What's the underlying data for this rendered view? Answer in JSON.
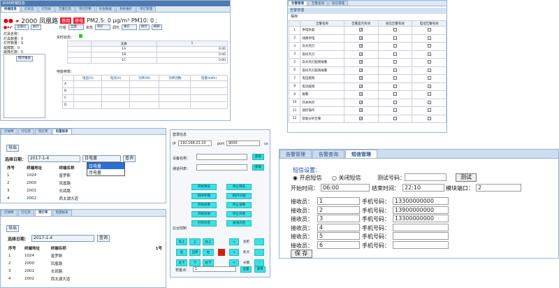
{
  "main": {
    "title": "2000终端信息",
    "tabs": [
      "终端信息",
      "灯状态",
      "灯列表",
      "告警信息",
      "单灯控制",
      "抄表数据",
      "系统维护",
      "单灯管理"
    ],
    "station": "2000 凤凰路",
    "badge1": "停用",
    "badge2": "停电",
    "pm": "PM2.5: 0 μg/m³ PM10: 0 ;",
    "sel1": "全部灯",
    "btn1": "执行",
    "lbl2": "灯组",
    "sel2": "全部",
    "lbl3": "状态",
    "sel3": "开灯",
    "lbl4": "调光",
    "sel4": "关灯",
    "btn2": "执行",
    "btn3": "刷新",
    "left": [
      "灯具名称：",
      "灯具数量：0",
      "灯杆数量：0",
      "故障数：0",
      "故障灯数：0"
    ],
    "stat_btn": "统计报表",
    "status_label": "实时状态：",
    "phase_head": [
      "",
      "支路",
      "1"
    ],
    "phase_rows": [
      [
        "1A",
        "0.00"
      ],
      [
        "1B",
        "0.00"
      ],
      [
        "1C",
        "0.00"
      ]
    ],
    "energy_label": "电能参数：",
    "energy_head": [
      "",
      "电压(V)",
      "电流(A)",
      "功率(W)",
      "功率因数",
      "电量(kWh)"
    ],
    "energy_rows": [
      "A",
      "B",
      "C",
      "D"
    ]
  },
  "alarm": {
    "tabs": [
      "告警管理",
      "告警查询",
      "短信管理"
    ],
    "title": "告警管理",
    "save": "保存",
    "head": [
      "",
      "告警名称",
      "告警是否有效",
      "短信告警有效",
      "电话告警有效"
    ],
    "rows": [
      [
        "1",
        "供电恢复"
      ],
      [
        "2",
        "线路停电"
      ],
      [
        "3",
        "白天亮灯"
      ],
      [
        "4",
        "夜间灭灯"
      ],
      [
        "5",
        "白天亮灯超限报警"
      ],
      [
        "6",
        "夜间灭灯超限报警"
      ],
      [
        "7",
        "电压越限"
      ],
      [
        "8",
        "电流越限"
      ],
      [
        "9",
        "报警"
      ],
      [
        "10",
        "开关失控"
      ],
      [
        "11",
        "遥控操作"
      ],
      [
        "12",
        "智能分析告警"
      ]
    ]
  },
  "report1": {
    "tabs": [
      "灯故障",
      "灯信息",
      "亮灯率",
      "电量报表"
    ],
    "export": "导出",
    "date_label": "选择日期：",
    "date": "2017-1-4",
    "sel": "日电量",
    "btn": "查询",
    "options": [
      "日电量",
      "月电量"
    ],
    "head": [
      "序号",
      "终端地址",
      "终端名称"
    ],
    "rows": [
      [
        "1",
        "1024",
        "普罗斯"
      ],
      [
        "2",
        "2000",
        "凤凰路"
      ],
      [
        "3",
        "2001",
        "长鸽路"
      ],
      [
        "4",
        "2002",
        "西太湖大道"
      ]
    ]
  },
  "report2": {
    "tabs": [
      "灯故障",
      "灯信息",
      "亮灯率",
      "电量报表"
    ],
    "export": "导出",
    "date_label": "选择日期：",
    "date": "2017-1-4",
    "btn": "查询",
    "head": [
      "序号",
      "终端地址",
      "终端名称",
      "1号"
    ],
    "rows": [
      [
        "1",
        "1024",
        "普罗斯"
      ],
      [
        "2",
        "2000",
        "凤凰路"
      ],
      [
        "3",
        "2001",
        "长鸽路"
      ],
      [
        "4",
        "2002",
        "西太湖大道"
      ]
    ]
  },
  "video": {
    "title": "登录信息",
    "ip_label": "IP",
    "ip": "192.168.22.10",
    "port_label": "port",
    "port": "9000",
    "us": "us",
    "dev_label": "设备名称：",
    "get1": "获取",
    "ch_label": "通道列表：",
    "get2": "获取",
    "btns": [
      "开始预览",
      "停止预览",
      "抓BMP图",
      "抓JPEG图",
      "开始录像",
      "停止录像",
      "开始对讲",
      "停止对讲",
      "打开声音",
      "关闭声音"
    ],
    "ptz_label": "云台控制",
    "dirs": [
      "左上",
      "上",
      "右上",
      "左",
      "自转",
      "右",
      "左下",
      "下",
      "右下"
    ],
    "side": [
      "+",
      "变距",
      "-",
      "+",
      "焦点",
      "-",
      "+",
      "光圈",
      "-"
    ],
    "preset_label": "预置点：",
    "preset": "1",
    "set": "设置",
    "call": "调用"
  },
  "sms": {
    "tabs": [
      "告警管理",
      "告警查询",
      "短信管理"
    ],
    "title": "短信设置：",
    "on": "开启短信",
    "off": "关闭短信",
    "test_label": "测试号码：",
    "test_btn": "测试",
    "start_label": "开始时间：",
    "start": "06:00",
    "end_label": "结束时间：",
    "end": "22:10",
    "port_label": "模块端口：",
    "port": "2",
    "rows": [
      [
        "接收员：",
        "1",
        "手机号码：",
        "13300000000"
      ],
      [
        "接收员：",
        "2",
        "手机号码：",
        "13900000000"
      ],
      [
        "接收员：",
        "3",
        "手机号码：",
        "13300000000"
      ],
      [
        "接收员：",
        "4",
        "手机号码：",
        ""
      ],
      [
        "接收员：",
        "5",
        "手机号码：",
        ""
      ],
      [
        "接收员：",
        "6",
        "手机号码：",
        ""
      ]
    ],
    "save": "保 存"
  }
}
